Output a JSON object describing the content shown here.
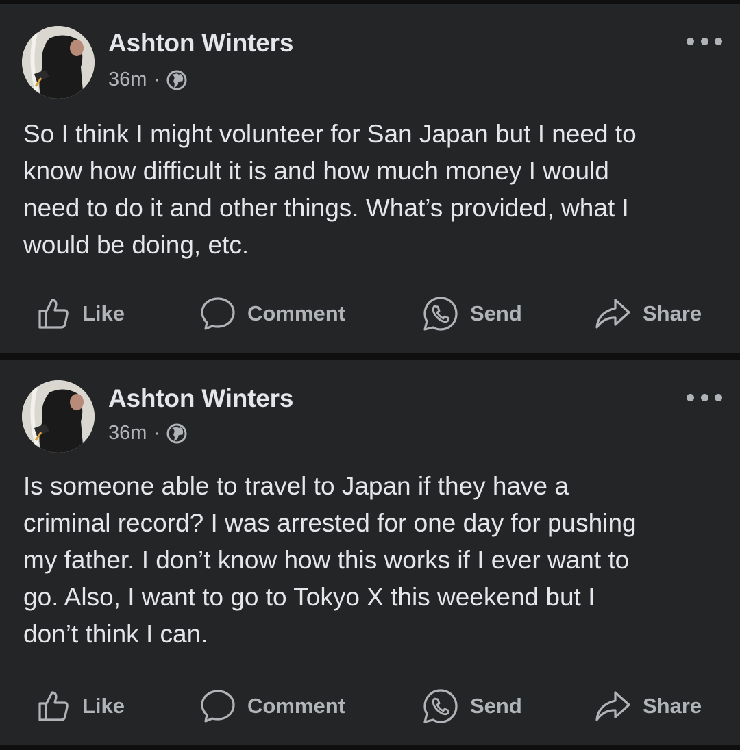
{
  "posts": [
    {
      "author": "Ashton Winters",
      "time": "36m",
      "separator": "·",
      "privacy_icon": "globe-icon",
      "text": "So I think I might volunteer for San Japan but I need to\nknow how difficult it is and how much money I would\nneed to do it and other things.  What’s provided, what I\nwould be doing, etc.",
      "actions": {
        "like": "Like",
        "comment": "Comment",
        "send": "Send",
        "share": "Share"
      }
    },
    {
      "author": "Ashton Winters",
      "time": "36m",
      "separator": "·",
      "privacy_icon": "globe-icon",
      "text": "Is someone able to travel to Japan if they have a\ncriminal record? I was arrested for one day for pushing\nmy father.  I don’t know how this works if I ever want to\ngo.  Also, I want to go to Tokyo X this weekend but I\ndon’t think I can.",
      "actions": {
        "like": "Like",
        "comment": "Comment",
        "send": "Send",
        "share": "Share"
      }
    }
  ],
  "colors": {
    "background": "#0f0f10",
    "card": "#242526",
    "primary_text": "#e4e6eb",
    "secondary_text": "#b0b3b8"
  }
}
